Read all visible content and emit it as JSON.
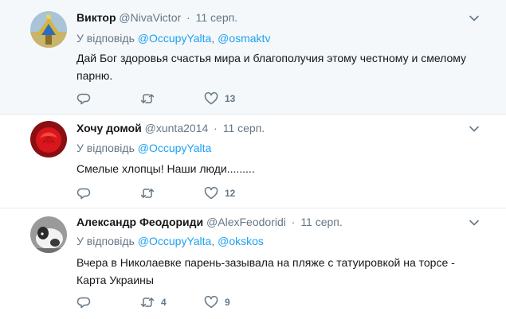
{
  "tweets": [
    {
      "fullname": "Виктор",
      "username": "@NivaVictor",
      "dot": "·",
      "time": "11 серп.",
      "reply_prefix": "У відповідь",
      "mentions": [
        "@OccupyYalta",
        "@osmaktv"
      ],
      "mention_separator": ", ",
      "text": "Дай Бог здоровья счастья мира и благополучия этому честному и смелому парню.",
      "reply_count": "",
      "retweet_count": "",
      "like_count": "13"
    },
    {
      "fullname": "Хочу домой",
      "username": "@xunta2014",
      "dot": "·",
      "time": "11 серп.",
      "reply_prefix": "У відповідь",
      "mentions": [
        "@OccupyYalta"
      ],
      "mention_separator": "",
      "text": "Смелые хлопцы! Наши люди.........",
      "reply_count": "",
      "retweet_count": "",
      "like_count": "12"
    },
    {
      "fullname": "Александр Феодориди",
      "username": "@AlexFeodoridi",
      "dot": "·",
      "time": "11 серп.",
      "reply_prefix": "У відповідь",
      "mentions": [
        "@OccupyYalta",
        "@okskos"
      ],
      "mention_separator": ", ",
      "text": "Вчера в Николаевке парень-зазывала на пляже с татуировкой на торсе - Карта Украины",
      "reply_count": "",
      "retweet_count": "4",
      "like_count": "9"
    }
  ],
  "colors": {
    "link": "#1da1f2",
    "secondary_text": "#657786",
    "primary_text": "#14171a",
    "highlight_background": "#f5f8fa",
    "divider": "#e6ecf0"
  },
  "icons": {
    "reply": "reply-icon",
    "retweet": "retweet-icon",
    "like": "heart-icon",
    "caret": "chevron-down-icon"
  }
}
